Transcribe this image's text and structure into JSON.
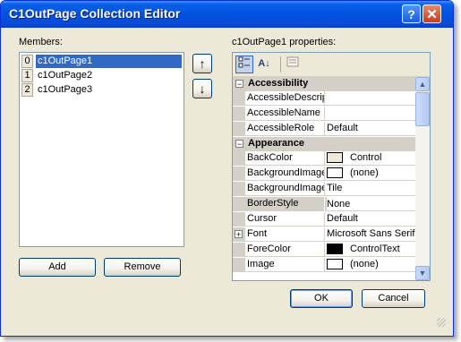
{
  "window": {
    "title": "C1OutPage Collection Editor",
    "help_label": "?",
    "close_label": "✕"
  },
  "members": {
    "label": "Members:",
    "items": [
      {
        "index": "0",
        "name": "c1OutPage1",
        "selected": true
      },
      {
        "index": "1",
        "name": "c1OutPage2",
        "selected": false
      },
      {
        "index": "2",
        "name": "c1OutPage3",
        "selected": false
      }
    ],
    "add_label": "Add",
    "remove_label": "Remove",
    "move_up_icon": "↑",
    "move_down_icon": "↓"
  },
  "properties": {
    "label": "c1OutPage1 properties:",
    "toolbar": {
      "categorized_icon": "categorized-icon",
      "alphabetical_icon": "alphabetical-icon",
      "property_pages_icon": "property-pages-icon",
      "alphabetical_glyph": "A↓"
    },
    "categories": [
      {
        "name": "Accessibility",
        "rows": [
          {
            "name": "AccessibleDescrip",
            "value": ""
          },
          {
            "name": "AccessibleName",
            "value": ""
          },
          {
            "name": "AccessibleRole",
            "value": "Default"
          }
        ]
      },
      {
        "name": "Appearance",
        "rows": [
          {
            "name": "BackColor",
            "value": "Control",
            "swatch": "#ece9d8"
          },
          {
            "name": "BackgroundImage",
            "value": "(none)",
            "swatch": "#ffffff"
          },
          {
            "name": "BackgroundImage",
            "value": "Tile"
          },
          {
            "name": "BorderStyle",
            "value": "None",
            "selected": true
          },
          {
            "name": "Cursor",
            "value": "Default"
          },
          {
            "name": "Font",
            "value": "Microsoft Sans Serif,",
            "expandable": true
          },
          {
            "name": "ForeColor",
            "value": "ControlText",
            "swatch": "#000000"
          },
          {
            "name": "Image",
            "value": "(none)",
            "swatch": "#ffffff"
          }
        ]
      }
    ]
  },
  "buttons": {
    "ok_label": "OK",
    "cancel_label": "Cancel"
  },
  "colors": {
    "selection": "#316ac5",
    "titlebar": "#0053e1",
    "dialog_bg": "#ece9d8"
  }
}
